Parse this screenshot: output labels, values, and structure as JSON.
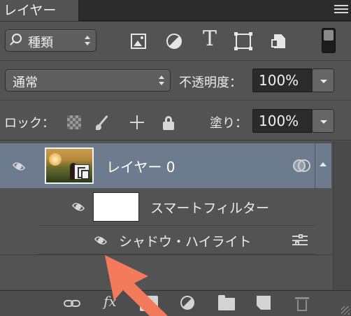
{
  "tab": {
    "title": "レイヤー"
  },
  "filter": {
    "kind_label": "種類"
  },
  "blend": {
    "mode": "通常",
    "opacity_label": "不透明度：",
    "opacity_value": "100%"
  },
  "lock": {
    "label": "ロック：",
    "fill_label": "塗り：",
    "fill_value": "100%"
  },
  "layers": {
    "main_name": "レイヤー 0",
    "smart_filter_label": "スマートフィルター",
    "filter_name": "シャドウ・ハイライト"
  },
  "bottom": {
    "fx_label": "fx"
  },
  "colors": {
    "selected_row": "#6c7c8e",
    "annotation_arrow": "#f47a5c",
    "panel_bg": "#535353"
  },
  "icons": [
    "panel-menu-icon",
    "search-icon",
    "image-filter-icon",
    "adjustment-filter-icon",
    "type-filter-icon",
    "shape-filter-icon",
    "smart-object-filter-icon",
    "filter-toggle-icon",
    "lock-transparent-icon",
    "lock-paint-icon",
    "lock-move-icon",
    "lock-all-icon",
    "eye-icon",
    "smart-object-badge-icon",
    "layer-effects-icon",
    "collapse-arrow-icon",
    "filter-options-icon",
    "link-icon",
    "fx-icon",
    "mask-icon",
    "adjustment-layer-icon",
    "folder-icon",
    "new-layer-icon",
    "trash-icon"
  ]
}
